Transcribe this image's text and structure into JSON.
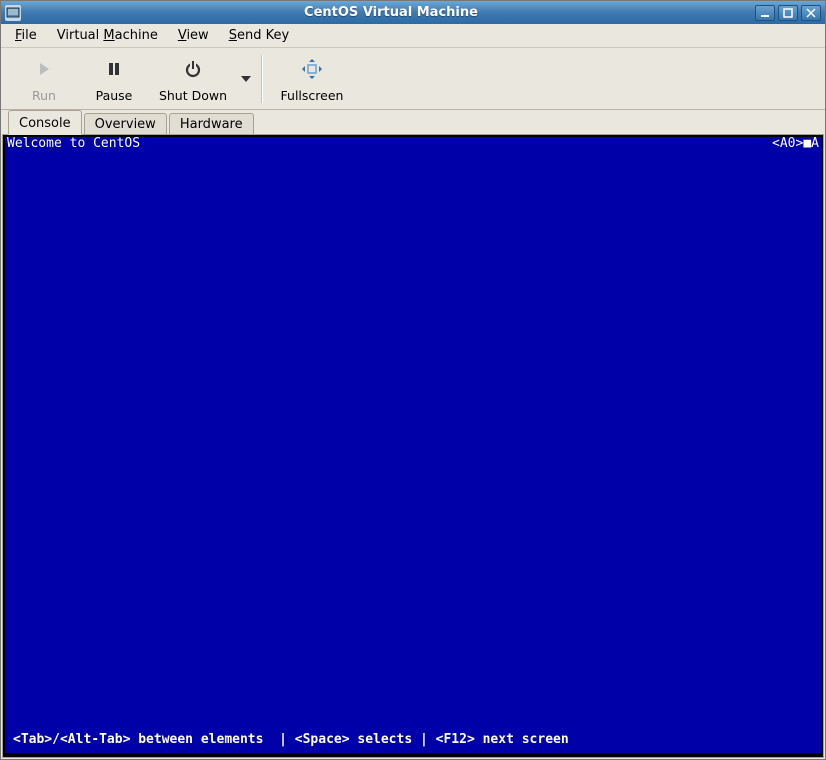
{
  "title": "CentOS Virtual Machine",
  "menubar": {
    "file": {
      "mnemonic": "F",
      "rest": "ile"
    },
    "vm": {
      "pre": "Virtual ",
      "mnemonic": "M",
      "rest": "achine"
    },
    "view": {
      "mnemonic": "V",
      "rest": "iew"
    },
    "sendkey": {
      "mnemonic": "S",
      "rest": "end Key"
    }
  },
  "toolbar": {
    "run": "Run",
    "pause": "Pause",
    "shutdown": "Shut Down",
    "fullscreen": "Fullscreen"
  },
  "tabs": {
    "console": "Console",
    "overview": "Overview",
    "hardware": "Hardware"
  },
  "console": {
    "welcome": "Welcome to CentOS",
    "topright": "<A0>■A",
    "bottom": "<Tab>/<Alt-Tab> between elements  | <Space> selects | <F12> next screen"
  }
}
